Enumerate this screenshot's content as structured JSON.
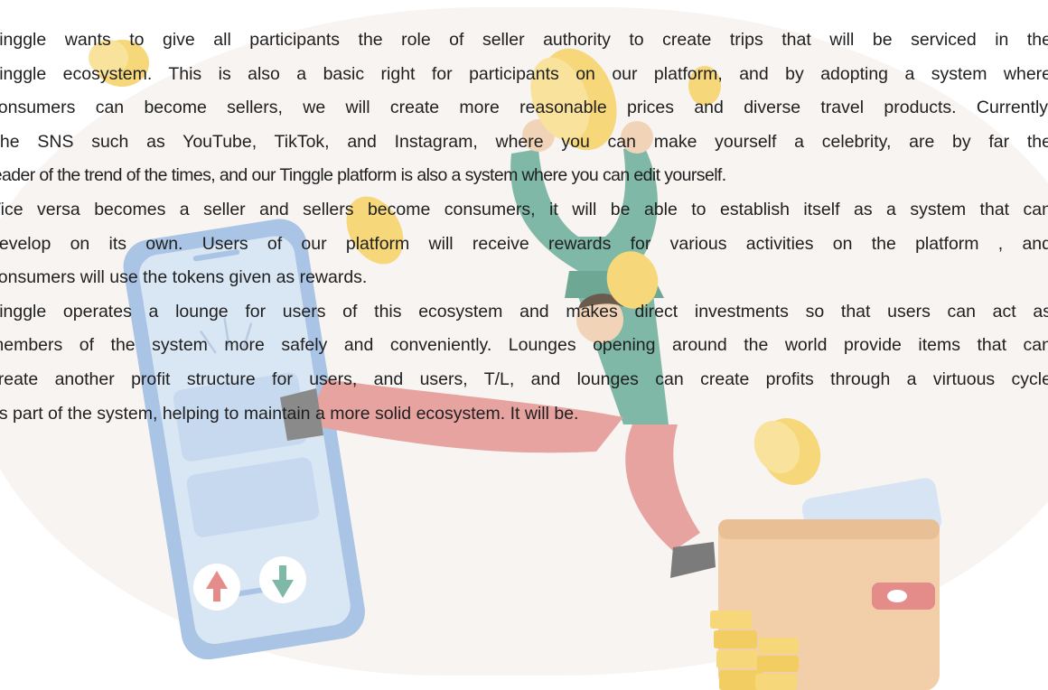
{
  "paragraphs": [
    {
      "lines": [
        "Tinggle wants to give all participants  the role of seller authority  to create trips that will be serviced  in the",
        "Tinggle ecosystem. This is also a basic right for participants on our platform, and by adopting a system where",
        "consumers can become sellers, we will create more reasonable prices and diverse travel products. Currently,",
        "The SNS such as YouTube, TikTok, and Instagram, where you can make yourself a celebrity, are by far the",
        "leader of the trend of the times, and our Tinggle platform is also a system where you can edit yourself."
      ]
    },
    {
      "lines": [
        "Vice versa becomes a seller and sellers become consumers, it will be able to establish itself as a system that can",
        "develop  on its own. Users of our platform  will receive  rewards  for various  activities  on the platform , and",
        "consumers will use the tokens given as rewards."
      ]
    },
    {
      "lines": [
        "Tinggle operates a lounge for users of this ecosystem and makes direct investments so that users can act as",
        "members of the system more safely and conveniently. Lounges opening around the world provide items that can",
        "create another profit structure for users, and users, T/L, and lounges can create profits through a virtuous cycle",
        "as part of the system, helping to maintain a more solid ecosystem. It will be."
      ]
    }
  ],
  "colors": {
    "background_blob": "#f7f4f2",
    "text": "#1f1f1f",
    "phone_body": "#a9c4e4",
    "phone_screen": "#d9e6f4",
    "shirt": "#7fb8a6",
    "pants": "#e7a3a0",
    "coin": "#f6d77a",
    "wallet": "#f2cfa9",
    "wallet_clasp": "#e48c8a"
  },
  "icons": [
    "smartphone-illustration",
    "up-arrow-icon",
    "down-arrow-icon",
    "jumping-man-illustration",
    "coin-icon",
    "wallet-illustration",
    "coin-stack-icon"
  ]
}
